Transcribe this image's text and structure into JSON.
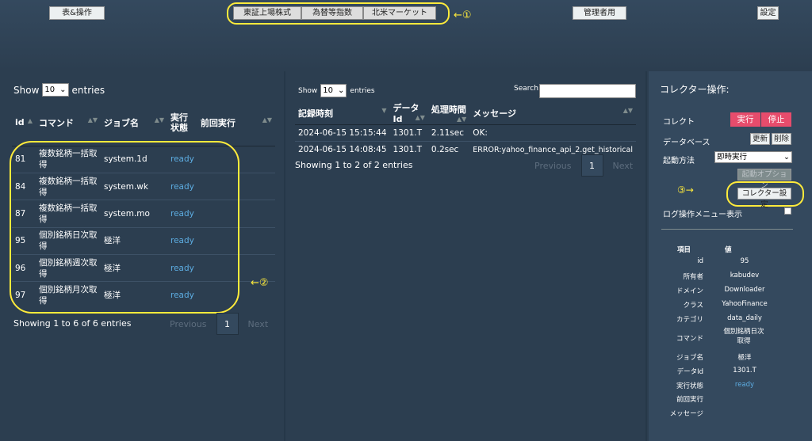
{
  "topbar": {
    "table_ops": "表&操作",
    "group": [
      "東証上場株式",
      "為替等指数",
      "北米マーケット"
    ],
    "admin": "管理者用",
    "settings": "設定",
    "anno1": "←①"
  },
  "left": {
    "show": "Show",
    "entries_count": "10",
    "entries": "entries",
    "columns": [
      "id",
      "コマンド",
      "ジョブ名",
      "実行状態",
      "前回実行"
    ],
    "rows": [
      {
        "id": "81",
        "cmd": "複数銘柄一括取得",
        "job": "system.1d",
        "status": "ready",
        "last": ""
      },
      {
        "id": "84",
        "cmd": "複数銘柄一括取得",
        "job": "system.wk",
        "status": "ready",
        "last": ""
      },
      {
        "id": "87",
        "cmd": "複数銘柄一括取得",
        "job": "system.mo",
        "status": "ready",
        "last": ""
      },
      {
        "id": "95",
        "cmd": "個別銘柄日次取得",
        "job": "極洋",
        "status": "ready",
        "last": ""
      },
      {
        "id": "96",
        "cmd": "個別銘柄週次取得",
        "job": "極洋",
        "status": "ready",
        "last": ""
      },
      {
        "id": "97",
        "cmd": "個別銘柄月次取得",
        "job": "極洋",
        "status": "ready",
        "last": ""
      }
    ],
    "info": "Showing 1 to 6 of 6 entries",
    "prev": "Previous",
    "page": "1",
    "next": "Next",
    "anno2": "←②"
  },
  "mid": {
    "show": "Show",
    "entries_count": "10",
    "entries": "entries",
    "search_label": "Search:",
    "search_value": "",
    "columns": [
      "記録時刻",
      "データId",
      "処理時間",
      "メッセージ"
    ],
    "rows": [
      {
        "time": "2024-06-15 15:15:44",
        "data_id": "1301.T",
        "dur": "2.11sec",
        "msg": "OK:"
      },
      {
        "time": "2024-06-15 14:08:45",
        "data_id": "1301.T",
        "dur": "0.2sec",
        "msg": "ERROR:yahoo_finance_api_2.get_historical"
      }
    ],
    "info": "Showing 1 to 2 of 2 entries",
    "prev": "Previous",
    "page": "1",
    "next": "Next"
  },
  "right": {
    "title": "コレクター操作:",
    "collect": "コレクト",
    "run": "実行",
    "stop": "停止",
    "database": "データベース",
    "update": "更新",
    "delete": "削除",
    "start_method": "起動方法",
    "start_method_value": "即時実行",
    "start_options": "起動オプション",
    "anno3": "③→",
    "collector_settings": "コレクター設定",
    "log_menu": "ログ操作メニュー表示",
    "prop_header_k": "項目",
    "prop_header_v": "値",
    "props": [
      {
        "k": "id",
        "v": "95"
      },
      {
        "k": "所有者",
        "v": "kabudev"
      },
      {
        "k": "ドメイン",
        "v": "Downloader"
      },
      {
        "k": "クラス",
        "v": "YahooFinance"
      },
      {
        "k": "カテゴリ",
        "v": "data_daily"
      },
      {
        "k": "コマンド",
        "v": "個別銘柄日次取得"
      },
      {
        "k": "ジョブ名",
        "v": "極洋"
      },
      {
        "k": "データId",
        "v": "1301.T"
      },
      {
        "k": "実行状態",
        "v": "ready"
      },
      {
        "k": "前回実行",
        "v": ""
      },
      {
        "k": "メッセージ",
        "v": ""
      }
    ]
  }
}
